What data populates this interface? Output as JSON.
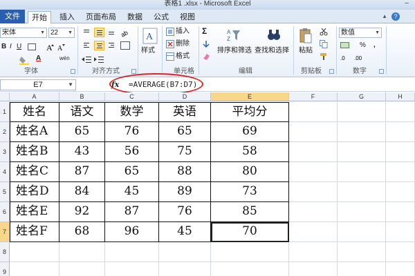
{
  "window": {
    "title": "表格1 .xlsx - Microsoft Excel",
    "minimize": "–"
  },
  "tabs": [
    {
      "label": "文件"
    },
    {
      "label": "开始"
    },
    {
      "label": "插入"
    },
    {
      "label": "页面布局"
    },
    {
      "label": "数据"
    },
    {
      "label": "公式"
    },
    {
      "label": "视图"
    }
  ],
  "ribbon": {
    "font": {
      "name": "宋体",
      "size": "22",
      "bold": "B",
      "italic": "I",
      "underline": "U",
      "font_color": "A",
      "phonetic": "wén",
      "label": "字体"
    },
    "alignment": {
      "label": "对齐方式"
    },
    "styles": {
      "label": "样式"
    },
    "cells": {
      "insert": "插入",
      "delete": "删除",
      "format": "格式",
      "label": "单元格"
    },
    "editing": {
      "sigma": "Σ",
      "sort_filter": "排序和筛选",
      "find_select": "查找和选择",
      "label": "编辑"
    },
    "clipboard": {
      "paste": "粘贴",
      "label": "剪贴板"
    },
    "number": {
      "format": "数值",
      "percent": "%",
      "comma": ",",
      "label": "数字"
    }
  },
  "formula_bar": {
    "name_box": "E7",
    "fx": "fx",
    "formula": "=AVERAGE(B7:D7)"
  },
  "sheet": {
    "columns": [
      "A",
      "B",
      "C",
      "D",
      "E",
      "F",
      "G",
      "H"
    ],
    "rows": [
      "1",
      "2",
      "3",
      "4",
      "5",
      "6",
      "7",
      "8",
      "9"
    ],
    "header": [
      "姓名",
      "语文",
      "数学",
      "英语",
      "平均分"
    ],
    "data": [
      [
        "姓名A",
        "65",
        "76",
        "65",
        "69"
      ],
      [
        "姓名B",
        "43",
        "56",
        "75",
        "58"
      ],
      [
        "姓名C",
        "87",
        "65",
        "88",
        "80"
      ],
      [
        "姓名D",
        "84",
        "45",
        "89",
        "73"
      ],
      [
        "姓名E",
        "92",
        "87",
        "76",
        "85"
      ],
      [
        "姓名F",
        "68",
        "96",
        "45",
        "70"
      ]
    ],
    "active_cell": "E7",
    "accent": "#f9d78a",
    "annotation_color": "#e02020"
  }
}
